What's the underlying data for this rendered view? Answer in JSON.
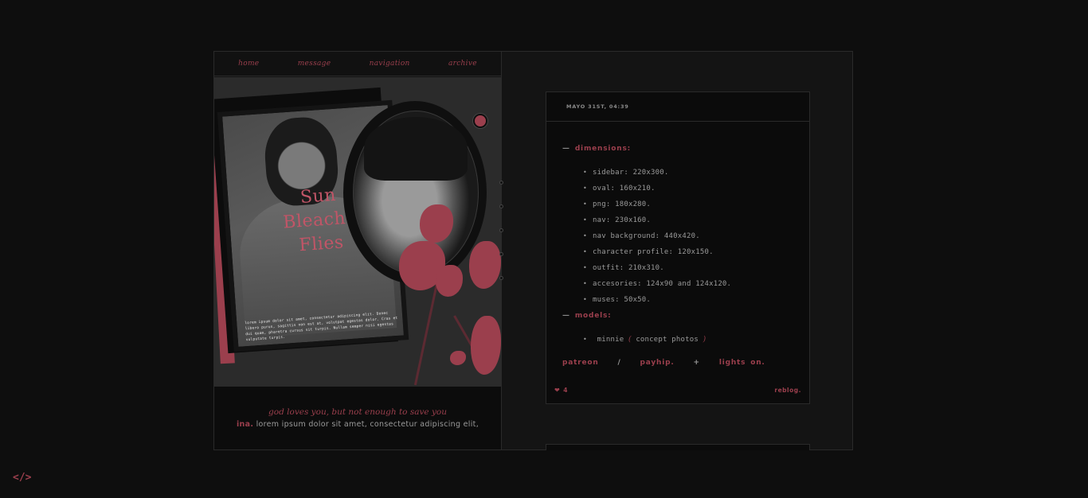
{
  "nav": {
    "items": [
      "home",
      "message",
      "navigation",
      "archive"
    ]
  },
  "artwork": {
    "title_lines": [
      "Sun",
      "Bleache",
      "Flies"
    ],
    "lorem": "lorem ipsum dolor sit amet, consectetur adipiscing elit. Donec libero purus, sagittis non est at, volutpat egestas dolor. Cras et dui quam, pharetra cursus sit turpis. Nullam semper nisi egestas vulputate turpis."
  },
  "quote": {
    "text": "god loves you, but not enough to save you",
    "name": "ina.",
    "bio": "lorem ipsum dolor sit amet, consectetur adipiscing elit,"
  },
  "post": {
    "date": "MAYO 31ST, 04:39",
    "dimensions_title": "dimensions:",
    "dimensions": [
      "sidebar: 220x300.",
      "oval: 160x210.",
      "png: 180x280.",
      "nav: 230x160.",
      "nav background: 440x420.",
      "character profile: 120x150.",
      "outfit: 210x310.",
      "accesories: 124x90 and 124x120.",
      "muses: 50x50."
    ],
    "models_title": "models:",
    "model_name": "minnie",
    "model_paren_open": "(",
    "model_note": "concept photos",
    "model_paren_close": ")",
    "links": {
      "patreon": "patreon",
      "sep1": "/",
      "payhip": "payhip.",
      "sep2": "+",
      "lights": "lights on."
    },
    "likes": "4",
    "reblog": "reblog."
  },
  "colors": {
    "accent": "#9b3f4d",
    "background": "#0e0e0e"
  },
  "icons": {
    "footer": "code-icon"
  }
}
